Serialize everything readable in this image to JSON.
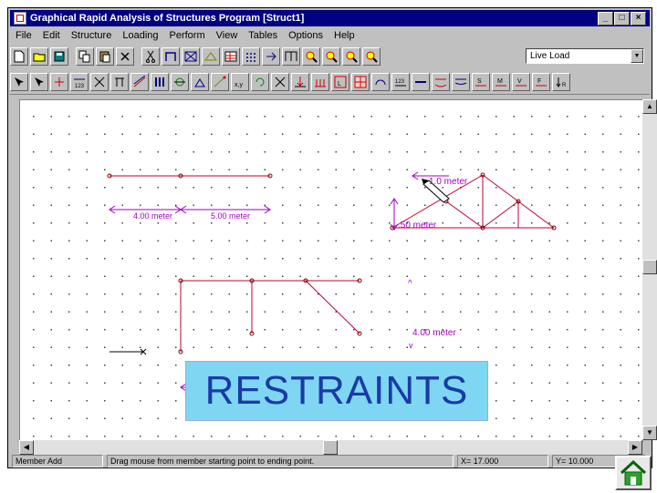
{
  "window": {
    "title": "Graphical Rapid Analysis of Structures Program [Struct1]",
    "controls": [
      "_",
      "□",
      "×"
    ]
  },
  "menu": [
    "File",
    "Edit",
    "Structure",
    "Loading",
    "Perform",
    "View",
    "Tables",
    "Options",
    "Help"
  ],
  "load_combo": {
    "value": "Live Load"
  },
  "canvas": {
    "labels": {
      "beam_left": "4.00 meter",
      "beam_right": "5.00 meter",
      "truss_width": "1.0 meter",
      "truss_height": ".50 meter",
      "frame_height": "4.00 meter",
      "up_arrow": "^",
      "down_arrow": "v"
    },
    "colors": {
      "member": "#c00030",
      "dimension": "#a000c0",
      "node": "#800000"
    }
  },
  "overlay_caption": "RESTRAINTS",
  "status": {
    "mode": "Member Add",
    "hint": "Drag mouse from member starting point to ending point.",
    "x": "X= 17.000",
    "y": "Y= 10.000"
  },
  "icons": {
    "home": "home-icon"
  }
}
